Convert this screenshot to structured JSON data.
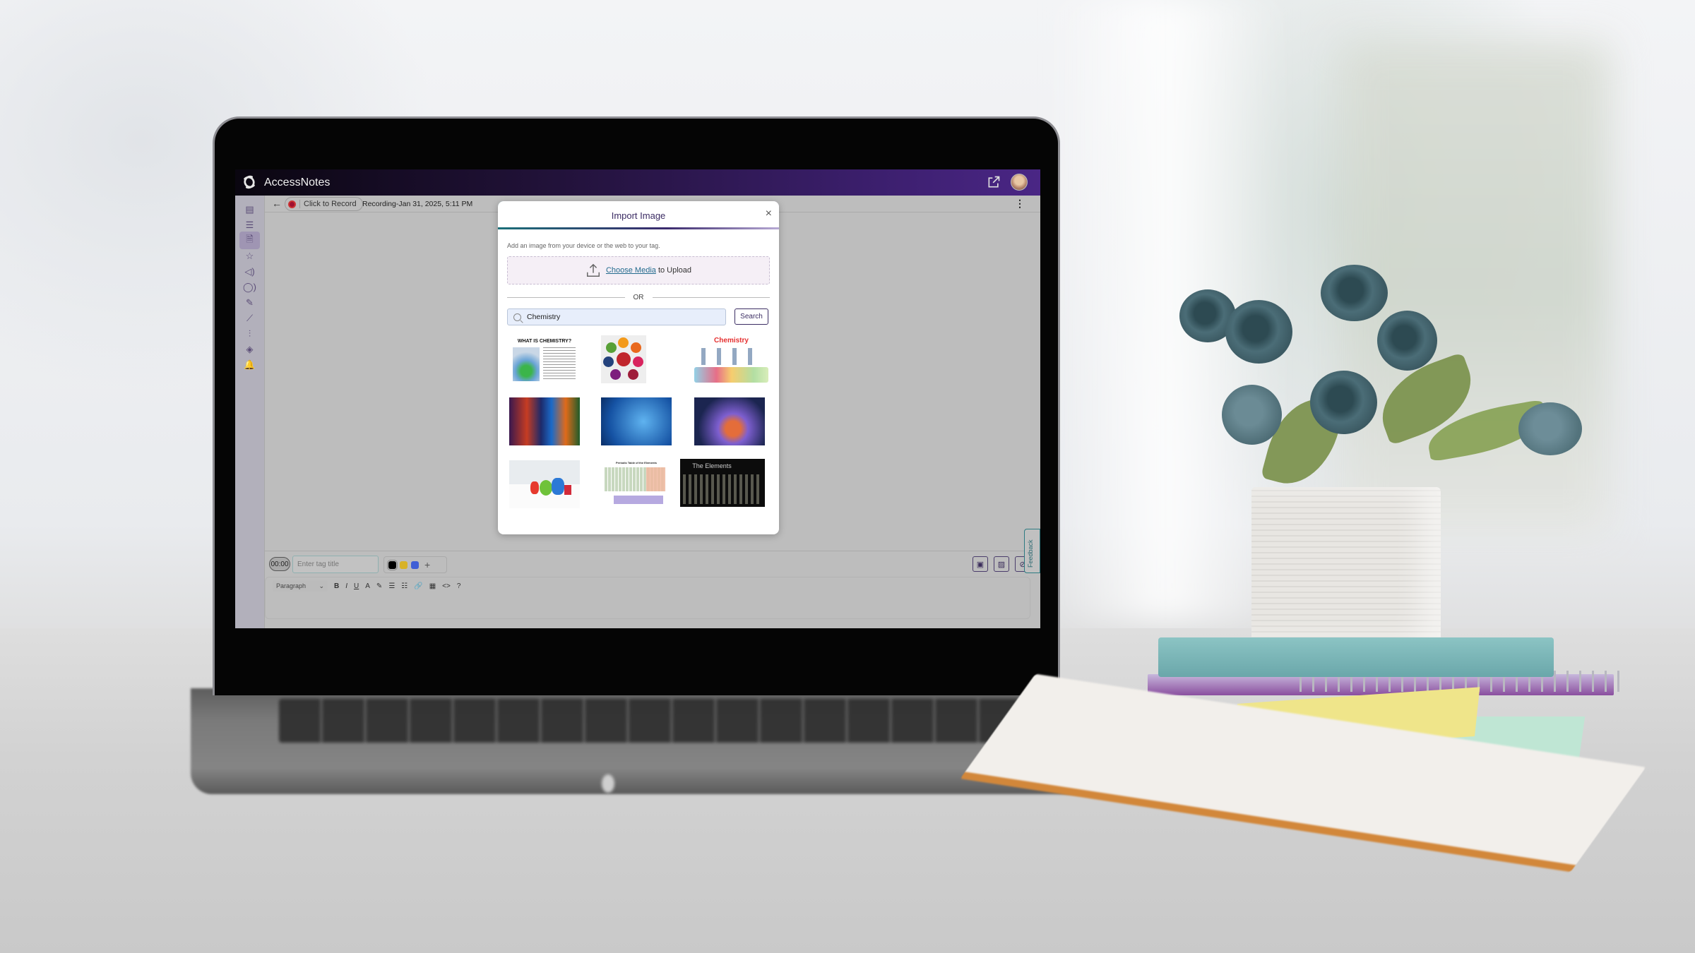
{
  "app": {
    "title": "AccessNotes",
    "header_icons": [
      "open-external-icon",
      "user-avatar"
    ]
  },
  "sidebar": {
    "items": [
      {
        "icon": "notes-icon",
        "glyph": "▤",
        "active": false
      },
      {
        "icon": "checklist-icon",
        "glyph": "☰",
        "active": false
      },
      {
        "icon": "audio-file-icon",
        "glyph": "🗎",
        "active": true
      },
      {
        "icon": "accessibility-icon",
        "glyph": "☆",
        "active": false
      },
      {
        "icon": "speaker-icon",
        "glyph": "◁)",
        "active": false
      },
      {
        "icon": "voice-user-icon",
        "glyph": "◯)",
        "active": false
      },
      {
        "icon": "highlighter-icon",
        "glyph": "✎",
        "active": false
      },
      {
        "icon": "chart-icon",
        "glyph": "⟋",
        "active": false
      },
      {
        "icon": "sliders-icon",
        "glyph": "⫶",
        "active": false
      },
      {
        "icon": "layers-icon",
        "glyph": "◈",
        "active": false
      },
      {
        "icon": "bell-icon",
        "glyph": "🔔",
        "active": false
      }
    ]
  },
  "toolbar": {
    "back_glyph": "←",
    "record_label": "Click to Record",
    "recording_title": "Recording-Jan 31, 2025, 5:11 PM",
    "menu_glyph": "⋮"
  },
  "modal": {
    "title": "Import Image",
    "close_glyph": "×",
    "description": "Add an image from your device or the web to your tag.",
    "upload_link": "Choose Media",
    "upload_suffix": " to Upload",
    "divider_text": "OR",
    "search_value": "Chemistry",
    "search_button": "Search",
    "results": [
      {
        "caption": "WHAT IS CHEMISTRY?",
        "theme": "infographic"
      },
      {
        "caption": "",
        "theme": "branches-diagram"
      },
      {
        "caption": "Chemistry",
        "theme": "cartoon-lab"
      },
      {
        "caption": "",
        "theme": "colorful-flasks-dark"
      },
      {
        "caption": "",
        "theme": "blue-periodic-glassware"
      },
      {
        "caption": "",
        "theme": "cosmic-flask"
      },
      {
        "caption": "",
        "theme": "lab-bench-flasks"
      },
      {
        "caption": "Periodic Table of the Elements",
        "theme": "periodic-table"
      },
      {
        "caption": "The Elements",
        "theme": "elements-dark"
      }
    ]
  },
  "bottom": {
    "timer": "00:00",
    "tag_placeholder": "Enter tag title",
    "colors": [
      "#000000",
      "#d8b226",
      "#3f5fd6"
    ],
    "add_color_glyph": "+",
    "feedback_label": "Feedback",
    "editor": {
      "block_format": "Paragraph",
      "tools": [
        "B",
        "I",
        "U",
        "A",
        "✎",
        "☰",
        "☷",
        "🔗",
        "▦",
        "<>",
        "?"
      ]
    }
  }
}
